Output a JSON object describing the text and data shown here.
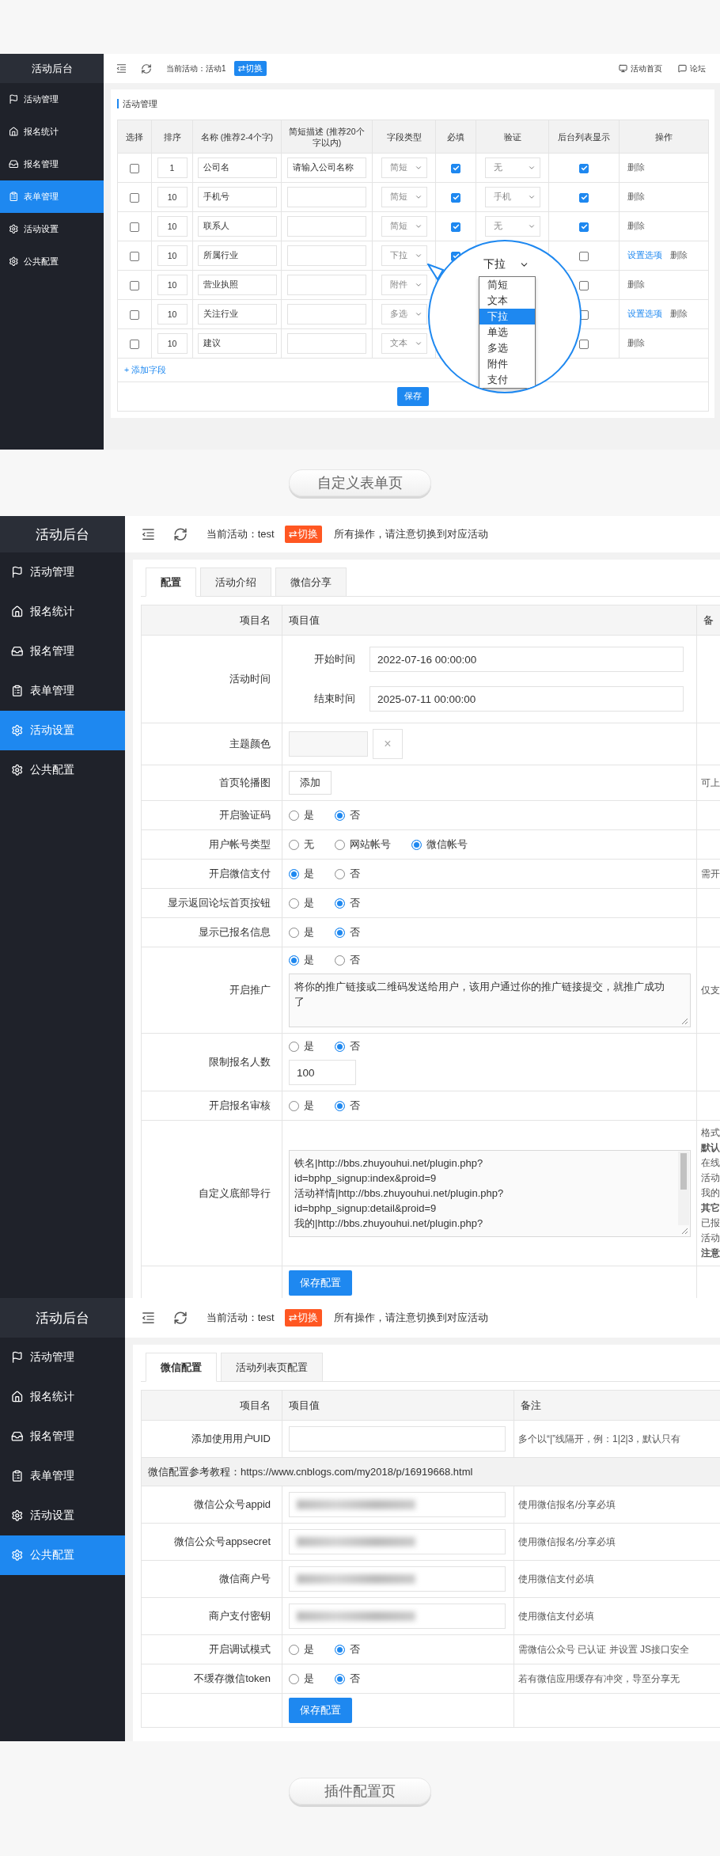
{
  "form_page": {
    "sidebar": {
      "title": "活动后台",
      "items": [
        {
          "label": "活动管理",
          "selected": false
        },
        {
          "label": "报名统计",
          "selected": false
        },
        {
          "label": "报名管理",
          "selected": false
        },
        {
          "label": "表单管理",
          "selected": true
        },
        {
          "label": "活动设置",
          "selected": false
        },
        {
          "label": "公共配置",
          "selected": false
        }
      ]
    },
    "header": {
      "current_activity": "当前活动：活动1",
      "switch": {
        "label": "⇄切换",
        "kind": "primary"
      },
      "links": [
        "活动首页",
        "论坛"
      ]
    },
    "panel_title": "活动管理",
    "table": {
      "columns": [
        "选择",
        "排序",
        "名称 (推荐2-4个字)",
        "简短描述 (推荐20个字以内)",
        "字段类型",
        "必填",
        "验证",
        "后台列表显示",
        "操作"
      ],
      "rows": [
        {
          "checked": false,
          "order": "1",
          "name": "公司名",
          "description": "请输入公司名称",
          "type": "简短",
          "required": true,
          "verify": "无",
          "list_display": true,
          "actions": [
            {
              "label": "删除",
              "kind": "delete"
            }
          ]
        },
        {
          "checked": false,
          "order": "10",
          "name": "手机号",
          "type": "简短",
          "required": true,
          "verify": "手机",
          "list_display": true,
          "actions": [
            {
              "label": "删除",
              "kind": "delete"
            }
          ]
        },
        {
          "checked": false,
          "order": "10",
          "name": "联系人",
          "type": "简短",
          "required": true,
          "verify": "无",
          "list_display": true,
          "actions": [
            {
              "label": "删除",
              "kind": "delete"
            }
          ]
        },
        {
          "checked": false,
          "order": "10",
          "name": "所属行业",
          "type": "下拉",
          "required": true,
          "list_display": false,
          "actions": [
            {
              "label": "设置选项",
              "kind": "options"
            },
            {
              "label": "删除",
              "kind": "delete"
            }
          ]
        },
        {
          "checked": false,
          "order": "10",
          "name": "营业执照",
          "type": "附件",
          "list_display": false,
          "actions": [
            {
              "label": "删除",
              "kind": "delete"
            }
          ]
        },
        {
          "checked": false,
          "order": "10",
          "name": "关注行业",
          "type": "多选",
          "list_display": false,
          "actions": [
            {
              "label": "设置选项",
              "kind": "options"
            },
            {
              "label": "删除",
              "kind": "delete"
            }
          ]
        },
        {
          "checked": false,
          "order": "10",
          "name": "建议",
          "type": "文本",
          "list_display": false,
          "actions": [
            {
              "label": "删除",
              "kind": "delete"
            }
          ]
        }
      ],
      "add_field": "+ 添加字段",
      "save": "保存"
    },
    "magnifier": {
      "value": "下拉",
      "options": [
        {
          "label": "简短",
          "selected": false
        },
        {
          "label": "文本",
          "selected": false
        },
        {
          "label": "下拉",
          "selected": true
        },
        {
          "label": "单选",
          "selected": false
        },
        {
          "label": "多选",
          "selected": false
        },
        {
          "label": "附件",
          "selected": false
        },
        {
          "label": "支付",
          "selected": false
        }
      ]
    }
  },
  "caption_1": "自定义表单页",
  "settings_page": {
    "sidebar": {
      "title": "活动后台",
      "items": [
        {
          "label": "活动管理",
          "selected": false
        },
        {
          "label": "报名统计",
          "selected": false
        },
        {
          "label": "报名管理",
          "selected": false
        },
        {
          "label": "表单管理",
          "selected": false
        },
        {
          "label": "活动设置",
          "selected": true
        },
        {
          "label": "公共配置",
          "selected": false
        }
      ]
    },
    "header": {
      "current_activity": "当前活动：test",
      "switch": {
        "label": "⇄切换",
        "kind": "warning"
      },
      "notice": "所有操作，请注意切换到对应活动"
    },
    "tabs": [
      {
        "label": "配置",
        "selected": true
      },
      {
        "label": "活动介绍",
        "selected": false
      },
      {
        "label": "微信分享",
        "selected": false
      }
    ],
    "table": {
      "columns": [
        "项目名",
        "项目值",
        "备"
      ],
      "rows": [
        {
          "kind": "datetimes",
          "label": "活动时间",
          "fields": [
            {
              "label": "开始时间",
              "value": "2022-07-16 00:00:00"
            },
            {
              "label": "结束时间",
              "value": "2025-07-11 00:00:00"
            }
          ]
        },
        {
          "kind": "color",
          "label": "主题颜色",
          "clear": "×"
        },
        {
          "kind": "button",
          "label": "首页轮播图",
          "button": "添加",
          "remark": "可上"
        },
        {
          "kind": "radio",
          "label": "开启验证码",
          "options": [
            {
              "label": "是",
              "selected": false
            },
            {
              "label": "否",
              "selected": true
            }
          ]
        },
        {
          "kind": "radio",
          "label": "用户帐号类型",
          "options": [
            {
              "label": "无",
              "selected": false
            },
            {
              "label": "网站帐号",
              "selected": false
            },
            {
              "label": "微信帐号",
              "selected": true
            }
          ]
        },
        {
          "kind": "radio",
          "label": "开启微信支付",
          "options": [
            {
              "label": "是",
              "selected": true
            },
            {
              "label": "否",
              "selected": false
            }
          ],
          "remark": "需开"
        },
        {
          "kind": "radio",
          "label": "显示返回论坛首页按钮",
          "options": [
            {
              "label": "是",
              "selected": false
            },
            {
              "label": "否",
              "selected": true
            }
          ]
        },
        {
          "kind": "radio",
          "label": "显示已报名信息",
          "options": [
            {
              "label": "是",
              "selected": false
            },
            {
              "label": "否",
              "selected": true
            }
          ]
        },
        {
          "kind": "radio_textarea",
          "label": "开启推广",
          "options": [
            {
              "label": "是",
              "selected": true
            },
            {
              "label": "否",
              "selected": false
            }
          ],
          "text": "将你的推广链接或二维码发送给用户，该用户通过你的推广链接提交，就推广成功了",
          "remark": "仅支"
        },
        {
          "kind": "radio_input",
          "label": "限制报名人数",
          "options": [
            {
              "label": "是",
              "selected": false
            },
            {
              "label": "否",
              "selected": true
            }
          ],
          "value": "100"
        },
        {
          "kind": "radio",
          "label": "开启报名审核",
          "options": [
            {
              "label": "是",
              "selected": false
            },
            {
              "label": "否",
              "selected": true
            }
          ]
        },
        {
          "kind": "textarea",
          "label": "自定义底部导行",
          "lines": [
            "铁名|http://bbs.zhuyouhui.net/plugin.php?",
            "id=bphp_signup:index&proid=9",
            "活动祥情|http://bbs.zhuyouhui.net/plugin.php?",
            "id=bphp_signup:detail&proid=9",
            "我的|http://bbs.zhuyouhui.net/plugin.php?"
          ],
          "remark_lines": [
            {
              "text": "格式",
              "emphasis": false
            },
            {
              "text": "默认",
              "emphasis": true
            },
            {
              "text": "在线",
              "emphasis": false
            },
            {
              "text": "活动",
              "emphasis": false
            },
            {
              "text": "我的",
              "emphasis": false
            },
            {
              "text": "其它",
              "emphasis": true
            },
            {
              "text": "已报",
              "emphasis": false
            },
            {
              "text": "活动",
              "emphasis": false
            },
            {
              "text": "注意",
              "emphasis": true
            }
          ]
        }
      ],
      "save": "保存配置"
    }
  },
  "plugin_page": {
    "sidebar": {
      "title": "活动后台",
      "items": [
        {
          "label": "活动管理",
          "selected": false
        },
        {
          "label": "报名统计",
          "selected": false
        },
        {
          "label": "报名管理",
          "selected": false
        },
        {
          "label": "表单管理",
          "selected": false
        },
        {
          "label": "活动设置",
          "selected": false
        },
        {
          "label": "公共配置",
          "selected": true
        }
      ]
    },
    "header": {
      "current_activity": "当前活动：test",
      "switch": {
        "label": "⇄切换",
        "kind": "warning"
      },
      "notice": "所有操作，请注意切换到对应活动"
    },
    "tabs": [
      {
        "label": "微信配置",
        "selected": true
      },
      {
        "label": "活动列表页配置",
        "selected": false
      }
    ],
    "table": {
      "columns": [
        "项目名",
        "项目值",
        "备注"
      ],
      "rows": [
        {
          "kind": "input",
          "label": "添加使用用户UID",
          "blurred": false,
          "remark": "多个以“|”线隔开，例：1|2|3，默认只有"
        },
        {
          "kind": "notice",
          "text": "微信配置参考教程：https://www.cnblogs.com/my2018/p/16919668.html"
        },
        {
          "kind": "input",
          "label": "微信公众号appid",
          "blurred": true,
          "remark": "使用微信报名/分享必填"
        },
        {
          "kind": "input",
          "label": "微信公众号appsecret",
          "blurred": true,
          "remark": "使用微信报名/分享必填"
        },
        {
          "kind": "input",
          "label": "微信商户号",
          "blurred": true,
          "remark": "使用微信支付必填"
        },
        {
          "kind": "input",
          "label": "商户支付密钥",
          "blurred": true,
          "remark": "使用微信支付必填"
        },
        {
          "kind": "radio",
          "label": "开启调试模式",
          "options": [
            {
              "label": "是",
              "selected": false
            },
            {
              "label": "否",
              "selected": true
            }
          ],
          "remark": "需微信公众号 已认证 并设置 JS接口安全"
        },
        {
          "kind": "radio",
          "label": "不缓存微信token",
          "options": [
            {
              "label": "是",
              "selected": false
            },
            {
              "label": "否",
              "selected": true
            }
          ],
          "remark": "若有微信应用缓存有冲突，导至分享无"
        }
      ],
      "save": "保存配置"
    }
  },
  "caption_2": "插件配置页"
}
